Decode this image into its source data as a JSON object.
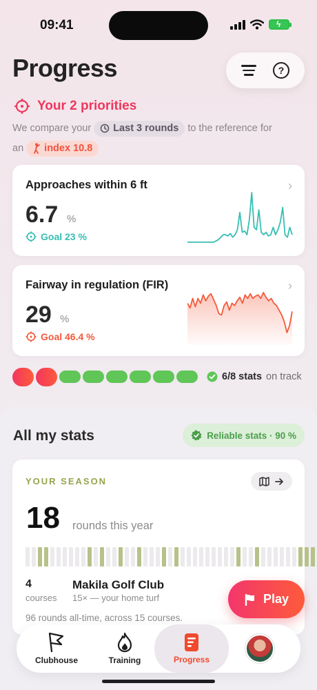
{
  "status": {
    "time": "09:41"
  },
  "header": {
    "title": "Progress"
  },
  "priorities": {
    "title": "Your 2 priorities",
    "intro_prefix": "We compare your",
    "rounds_chip": "Last 3 rounds",
    "intro_middle": "to the reference for",
    "intro_an": "an",
    "index_chip": "index 10.8"
  },
  "stats": [
    {
      "title": "Approaches within 6 ft",
      "value": "6.7",
      "unit": "%",
      "goal": "Goal 23 %",
      "color": "#35bfb2",
      "trend": [
        0,
        0,
        0,
        0,
        0,
        0,
        0,
        0,
        0,
        0,
        0,
        0,
        0.5,
        1,
        2,
        3,
        3,
        2.5,
        3.5,
        2,
        3,
        5,
        12,
        4,
        4.5,
        3,
        9,
        20,
        6,
        5,
        13,
        4,
        3,
        4,
        2.5,
        3,
        6,
        3,
        5,
        8,
        14,
        3,
        2,
        6,
        3
      ]
    },
    {
      "title": "Fairway in regulation (FIR)",
      "value": "29",
      "unit": "%",
      "goal": "Goal 46.4 %",
      "color": "#f35a3c",
      "trend": [
        40,
        36,
        44,
        37,
        44,
        40,
        47,
        42,
        46,
        48,
        43,
        38,
        31,
        30,
        38,
        41,
        34,
        40,
        38,
        42,
        45,
        40,
        47,
        44,
        48,
        44,
        46,
        47,
        44,
        49,
        45,
        42,
        44,
        40,
        38,
        34,
        30,
        24,
        15,
        21,
        33
      ]
    }
  ],
  "track": {
    "on_track": 6,
    "total": 8,
    "off_track": 2,
    "count": "6/8 stats",
    "suffix": "on track"
  },
  "all_stats": {
    "title": "All my stats",
    "reliable": "Reliable stats · 90 %"
  },
  "season": {
    "label": "YOUR SEASON",
    "rounds": "18",
    "rounds_caption": "rounds this year",
    "weeks_played": [
      0,
      0,
      1,
      1,
      0,
      0,
      0,
      0,
      0,
      0,
      1,
      0,
      1,
      0,
      0,
      1,
      0,
      0,
      1,
      0,
      0,
      0,
      1,
      0,
      1,
      0,
      0,
      0,
      0,
      0,
      0,
      0,
      0,
      0,
      1,
      0,
      0,
      1,
      0,
      0,
      0,
      0,
      0,
      0,
      1,
      1,
      1
    ],
    "courses_count": "4",
    "courses_label": "courses",
    "club": "Makila Golf Club",
    "club_sub": "15× — your home turf",
    "alltime": "96 rounds all-time, across 15 courses."
  },
  "play_label": "Play",
  "tabs": [
    {
      "label": "Clubhouse",
      "icon": "flag-icon"
    },
    {
      "label": "Training",
      "icon": "flame-icon"
    },
    {
      "label": "Progress",
      "icon": "progress-icon"
    },
    {
      "label": "",
      "icon": "avatar"
    }
  ]
}
